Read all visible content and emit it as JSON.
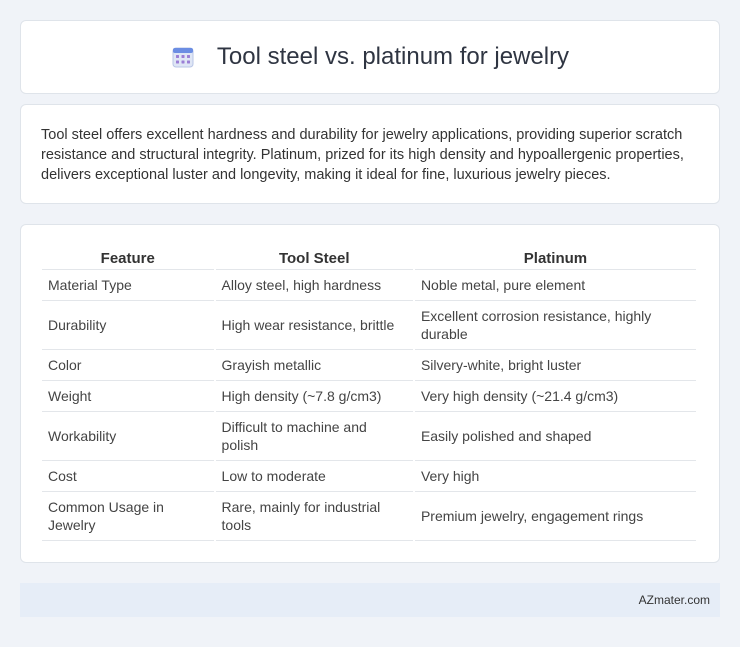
{
  "header": {
    "title": "Tool steel vs. platinum for jewelry",
    "icon": "calendar-grid-icon"
  },
  "summary": {
    "text": "Tool steel offers excellent hardness and durability for jewelry applications, providing superior scratch resistance and structural integrity. Platinum, prized for its high density and hypoallergenic properties, delivers exceptional luster and longevity, making it ideal for fine, luxurious jewelry pieces."
  },
  "table": {
    "headers": [
      "Feature",
      "Tool Steel",
      "Platinum"
    ],
    "rows": [
      [
        "Material Type",
        "Alloy steel, high hardness",
        "Noble metal, pure element"
      ],
      [
        "Durability",
        "High wear resistance, brittle",
        "Excellent corrosion resistance, highly durable"
      ],
      [
        "Color",
        "Grayish metallic",
        "Silvery-white, bright luster"
      ],
      [
        "Weight",
        "High density (~7.8 g/cm3)",
        "Very high density (~21.4 g/cm3)"
      ],
      [
        "Workability",
        "Difficult to machine and polish",
        "Easily polished and shaped"
      ],
      [
        "Cost",
        "Low to moderate",
        "Very high"
      ],
      [
        "Common Usage in Jewelry",
        "Rare, mainly for industrial tools",
        "Premium jewelry, engagement rings"
      ]
    ]
  },
  "footer": {
    "brand": "AZmater.com"
  }
}
